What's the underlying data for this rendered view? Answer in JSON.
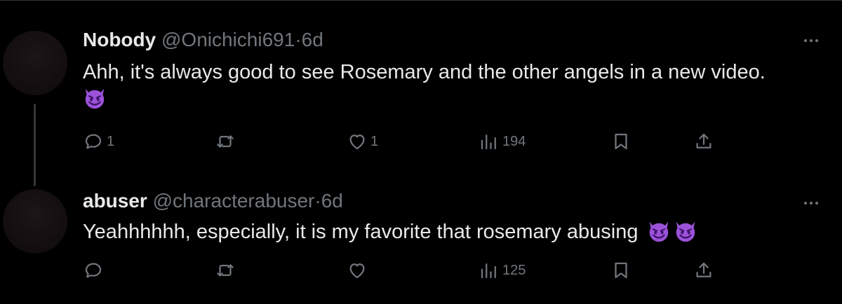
{
  "colors": {
    "background": "#000000",
    "text": "#e7e9ea",
    "secondary": "#71767b",
    "emoji": "#9b52d9"
  },
  "tweets": [
    {
      "name": "Nobody",
      "handle": "@Onichichi691",
      "separator": "·",
      "time": "6d",
      "text": "Ahh, it's always good to see Rosemary and the other angels in a new video.",
      "emoji_icons": [
        "smiling-imp-icon"
      ],
      "replies": "1",
      "retweets": "",
      "likes": "1",
      "views": "194"
    },
    {
      "name": "abuser",
      "handle": "@characterabuser",
      "separator": "·",
      "time": "6d",
      "text": "Yeahhhhhh, especially, it is my favorite that rosemary abusing",
      "emoji_icons": [
        "smiling-imp-icon",
        "smiling-imp-icon"
      ],
      "replies": "",
      "retweets": "",
      "likes": "",
      "views": "125"
    }
  ]
}
